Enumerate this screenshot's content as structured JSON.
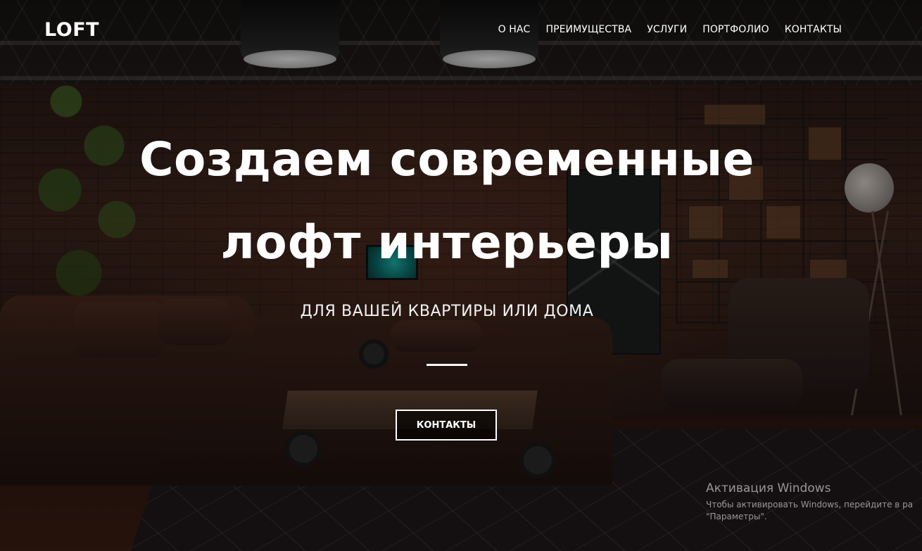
{
  "header": {
    "logo": "LOFT",
    "nav": [
      {
        "label": "О НАС"
      },
      {
        "label": "ПРЕИМУЩЕСТВА"
      },
      {
        "label": "УСЛУГИ"
      },
      {
        "label": "ПОРТФОЛИО"
      },
      {
        "label": "КОНТАКТЫ"
      }
    ]
  },
  "hero": {
    "title_line1": "Создаем современные",
    "title_line2": "лофт интерьеры",
    "subtitle": "ДЛЯ ВАШЕЙ КВАРТИРЫ ИЛИ ДОМА",
    "cta_label": "КОНТАКТЫ"
  },
  "watermark": {
    "title": "Активация Windows",
    "line1": "Чтобы активировать Windows, перейдите в ра",
    "line2": "\"Параметры\"."
  },
  "colors": {
    "text": "#ffffff",
    "background_tone": "#2a1a15"
  }
}
